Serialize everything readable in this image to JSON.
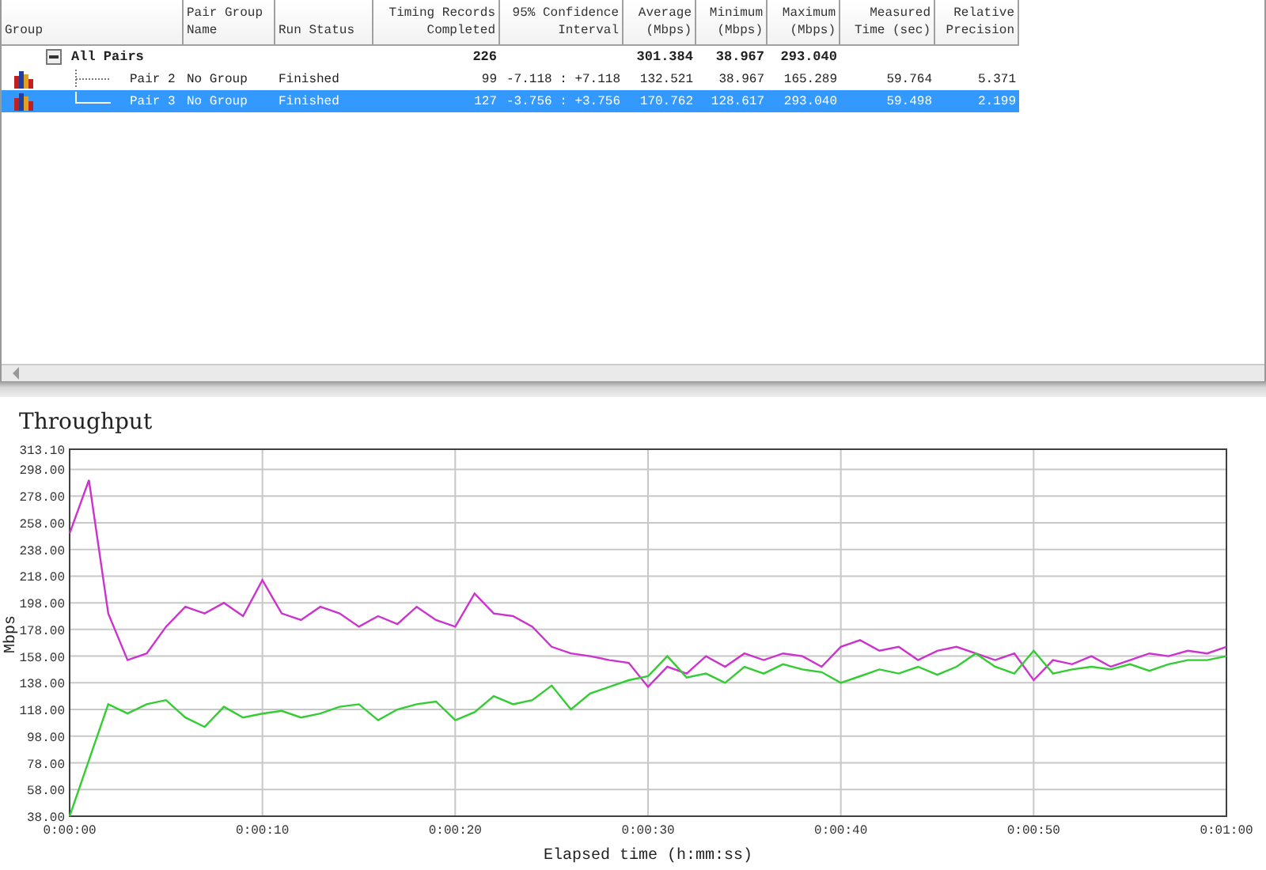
{
  "table": {
    "columns": [
      "Group",
      "Pair Group\nName",
      "Run Status",
      "Timing Records\nCompleted",
      "95% Confidence\nInterval",
      "Average\n(Mbps)",
      "Minimum\n(Mbps)",
      "Maximum\n(Mbps)",
      "Measured\nTime (sec)",
      "Relative\nPrecision"
    ],
    "rows": [
      {
        "group": "All Pairs",
        "expanded": true,
        "selected": false,
        "timing_records": "226",
        "average": "301.384",
        "minimum": "38.967",
        "maximum": "293.040",
        "children": [
          {
            "group": "Pair 2",
            "pair_group_name": "No Group",
            "run_status": "Finished",
            "timing_records": "99",
            "confidence_interval": "-7.118 : +7.118",
            "average": "132.521",
            "minimum": "38.967",
            "maximum": "165.289",
            "measured_time": "59.764",
            "relative_precision": "5.371",
            "selected": false
          },
          {
            "group": "Pair 3",
            "pair_group_name": "No Group",
            "run_status": "Finished",
            "timing_records": "127",
            "confidence_interval": "-3.756 : +3.756",
            "average": "170.762",
            "minimum": "128.617",
            "maximum": "293.040",
            "measured_time": "59.498",
            "relative_precision": "2.199",
            "selected": true
          }
        ]
      }
    ]
  },
  "chart": {
    "title": "Throughput",
    "chart_data": {
      "type": "line",
      "grid": true,
      "xlabel": "Elapsed time (h:mm:ss)",
      "ylabel": "Mbps",
      "x": [
        0,
        1,
        2,
        3,
        4,
        5,
        6,
        7,
        8,
        9,
        10,
        11,
        12,
        13,
        14,
        15,
        16,
        17,
        18,
        19,
        20,
        21,
        22,
        23,
        24,
        25,
        26,
        27,
        28,
        29,
        30,
        31,
        32,
        33,
        34,
        35,
        36,
        37,
        38,
        39,
        40,
        41,
        42,
        43,
        44,
        45,
        46,
        47,
        48,
        49,
        50,
        51,
        52,
        53,
        54,
        55,
        56,
        57,
        58,
        59,
        60
      ],
      "series": [
        {
          "color": "#cc33cc",
          "values": [
            250,
            290,
            190,
            155,
            160,
            180,
            195,
            190,
            198,
            188,
            215,
            190,
            185,
            195,
            190,
            180,
            188,
            182,
            195,
            185,
            180,
            205,
            190,
            188,
            180,
            165,
            160,
            158,
            155,
            153,
            135,
            150,
            145,
            158,
            150,
            160,
            155,
            160,
            158,
            150,
            165,
            170,
            162,
            165,
            155,
            162,
            165,
            160,
            155,
            160,
            140,
            155,
            152,
            158,
            150,
            155,
            160,
            158,
            162,
            160,
            165
          ]
        },
        {
          "color": "#33cc33",
          "values": [
            38,
            80,
            122,
            115,
            122,
            125,
            112,
            105,
            120,
            112,
            115,
            117,
            112,
            115,
            120,
            122,
            110,
            118,
            122,
            124,
            110,
            116,
            128,
            122,
            125,
            136,
            118,
            130,
            135,
            140,
            143,
            158,
            142,
            145,
            138,
            150,
            145,
            152,
            148,
            146,
            138,
            143,
            148,
            145,
            150,
            144,
            150,
            160,
            150,
            145,
            162,
            145,
            148,
            150,
            148,
            152,
            147,
            152,
            155,
            155,
            158
          ]
        }
      ],
      "xlim": [
        0,
        60
      ],
      "ylim": [
        38,
        313.1
      ],
      "xticks": [
        {
          "value": 0,
          "label": "0:00:00"
        },
        {
          "value": 10,
          "label": "0:00:10"
        },
        {
          "value": 20,
          "label": "0:00:20"
        },
        {
          "value": 30,
          "label": "0:00:30"
        },
        {
          "value": 40,
          "label": "0:00:40"
        },
        {
          "value": 50,
          "label": "0:00:50"
        },
        {
          "value": 60,
          "label": "0:01:00"
        }
      ],
      "yticks": [
        {
          "value": 38,
          "label": "38.00"
        },
        {
          "value": 58,
          "label": "58.00"
        },
        {
          "value": 78,
          "label": "78.00"
        },
        {
          "value": 98,
          "label": "98.00"
        },
        {
          "value": 118,
          "label": "118.00"
        },
        {
          "value": 138,
          "label": "138.00"
        },
        {
          "value": 158,
          "label": "158.00"
        },
        {
          "value": 178,
          "label": "178.00"
        },
        {
          "value": 198,
          "label": "198.00"
        },
        {
          "value": 218,
          "label": "218.00"
        },
        {
          "value": 238,
          "label": "238.00"
        },
        {
          "value": 258,
          "label": "258.00"
        },
        {
          "value": 278,
          "label": "278.00"
        },
        {
          "value": 298,
          "label": "298.00"
        },
        {
          "value": 313.1,
          "label": "313.10"
        }
      ]
    }
  }
}
